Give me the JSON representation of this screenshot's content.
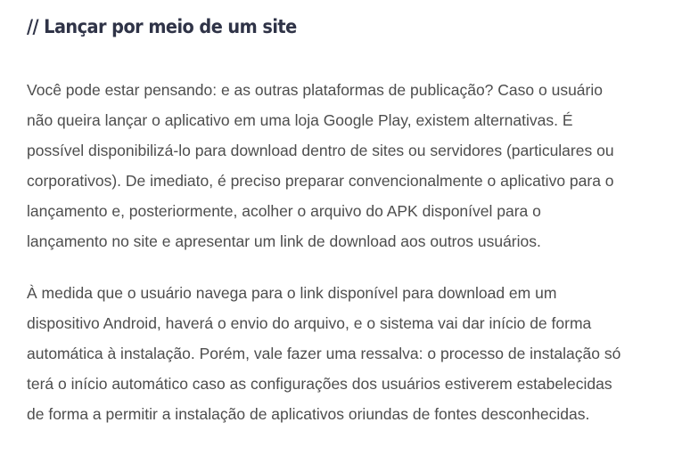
{
  "section": {
    "heading": "// Lançar por meio de um site",
    "paragraphs": [
      {
        "lines": [
          "Você pode estar pensando: e as outras plataformas de publicação? Caso o usuário",
          "não queira lançar o aplicativo em uma loja Google Play, existem alternativas. É",
          "possível disponibilizá-lo para download dentro de sites ou servidores (particulares ou",
          "corporativos). De imediato, é preciso preparar convencionalmente o aplicativo para o",
          "lançamento e, posteriormente, acolher o arquivo do APK disponível para o",
          "lançamento no site e apresentar um link de download aos outros usuários."
        ]
      },
      {
        "lines": [
          "À medida que o usuário navega para o link disponível para download em um",
          "dispositivo Android, haverá o envio do arquivo, e o sistema vai dar início de forma",
          "automática à instalação. Porém, vale fazer uma ressalva: o processo de instalação só",
          "terá o início automático caso as configurações dos usuários estiverem estabelecidas",
          "de forma a permitir a instalação de aplicativos oriundas de fontes desconhecidas."
        ]
      }
    ]
  }
}
